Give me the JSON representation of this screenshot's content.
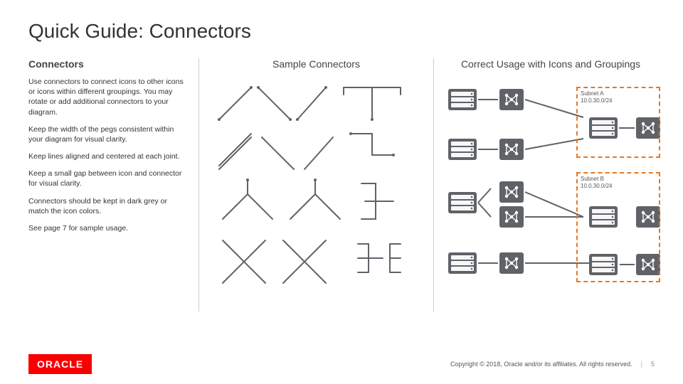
{
  "title": "Quick Guide: Connectors",
  "left": {
    "heading": "Connectors",
    "p1": "Use connectors to connect icons to other icons or icons within different groupings. You may rotate or add additional connectors to your diagram.",
    "p2": "Keep the width of the pegs consistent within your diagram for visual clarity.",
    "p3": "Keep lines aligned and centered at each joint.",
    "p4": "Keep a small gap between icon and connector for visual clarity.",
    "p5": "Connectors should be kept in dark grey or match the icon colors.",
    "p6": "See page 7 for sample usage."
  },
  "mid": {
    "heading": "Sample Connectors"
  },
  "right": {
    "heading": "Correct Usage with Icons and Groupings",
    "subnetA": {
      "name": "Subnet A",
      "cidr": "10.0.30.0/24"
    },
    "subnetB": {
      "name": "Subnet B",
      "cidr": "10.0.30.0/24"
    }
  },
  "footer": {
    "logo": "ORACLE",
    "copyright": "Copyright © 2018, Oracle and/or its affiliates. All rights reserved.",
    "page": "5"
  },
  "colors": {
    "connector": "#5f6368",
    "icon": "#5f6368",
    "accent": "#e87722",
    "oracleRed": "#f80000"
  }
}
